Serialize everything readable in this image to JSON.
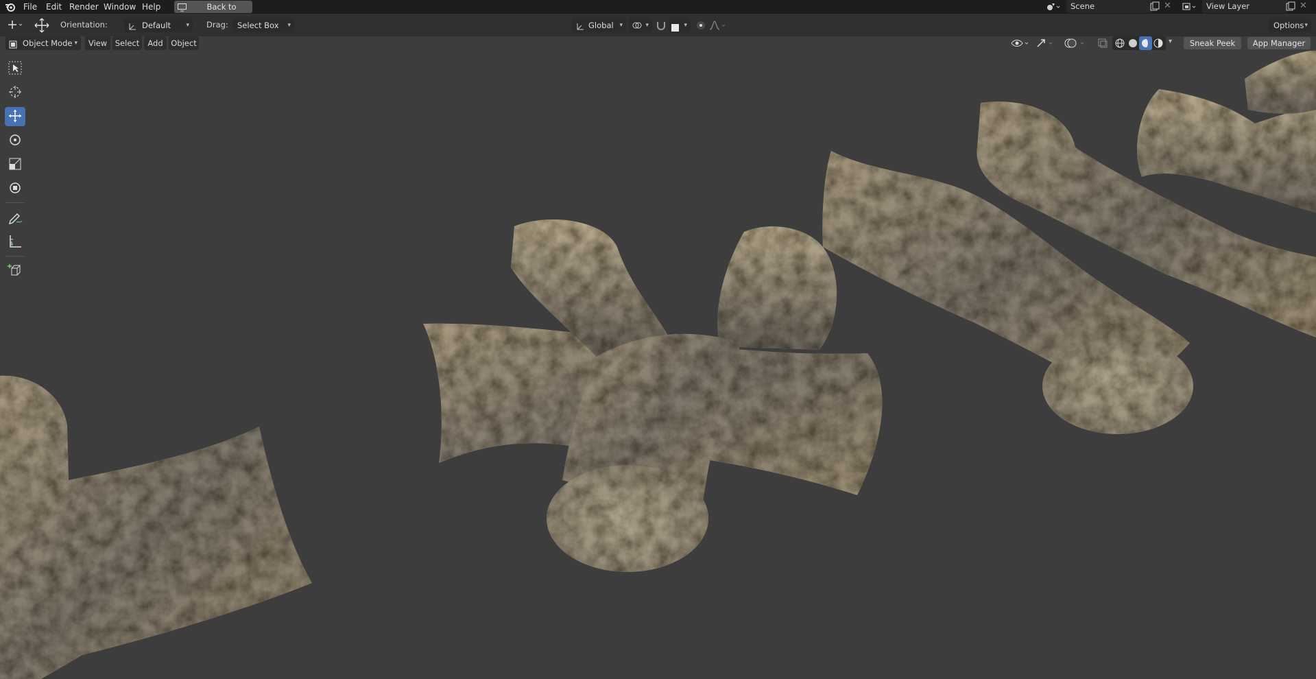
{
  "menubar": {
    "items": [
      "File",
      "Edit",
      "Render",
      "Window",
      "Help"
    ],
    "back_button": "Back to Previous",
    "scene_name": "Scene",
    "view_layer": "View Layer"
  },
  "toolbar": {
    "orientation_label": "Orientation:",
    "orientation_value": "Default",
    "drag_label": "Drag:",
    "drag_value": "Select Box",
    "transform_orientation": "Global",
    "options_label": "Options"
  },
  "viewport_header": {
    "mode": "Object Mode",
    "menus": [
      "View",
      "Select",
      "Add",
      "Object"
    ],
    "sneak_peek": "Sneak Peek",
    "app_manager": "App Manager"
  },
  "tools": [
    "select-box-icon",
    "cursor-icon",
    "move-icon",
    "rotate-icon",
    "scale-icon",
    "transform-icon",
    "annotate-icon",
    "measure-icon",
    "add-cube-icon"
  ],
  "colors": {
    "background": "#3d3d3d",
    "accent": "#4772b3",
    "rock_dark": "#5c574c",
    "rock_light": "#a89c82"
  }
}
